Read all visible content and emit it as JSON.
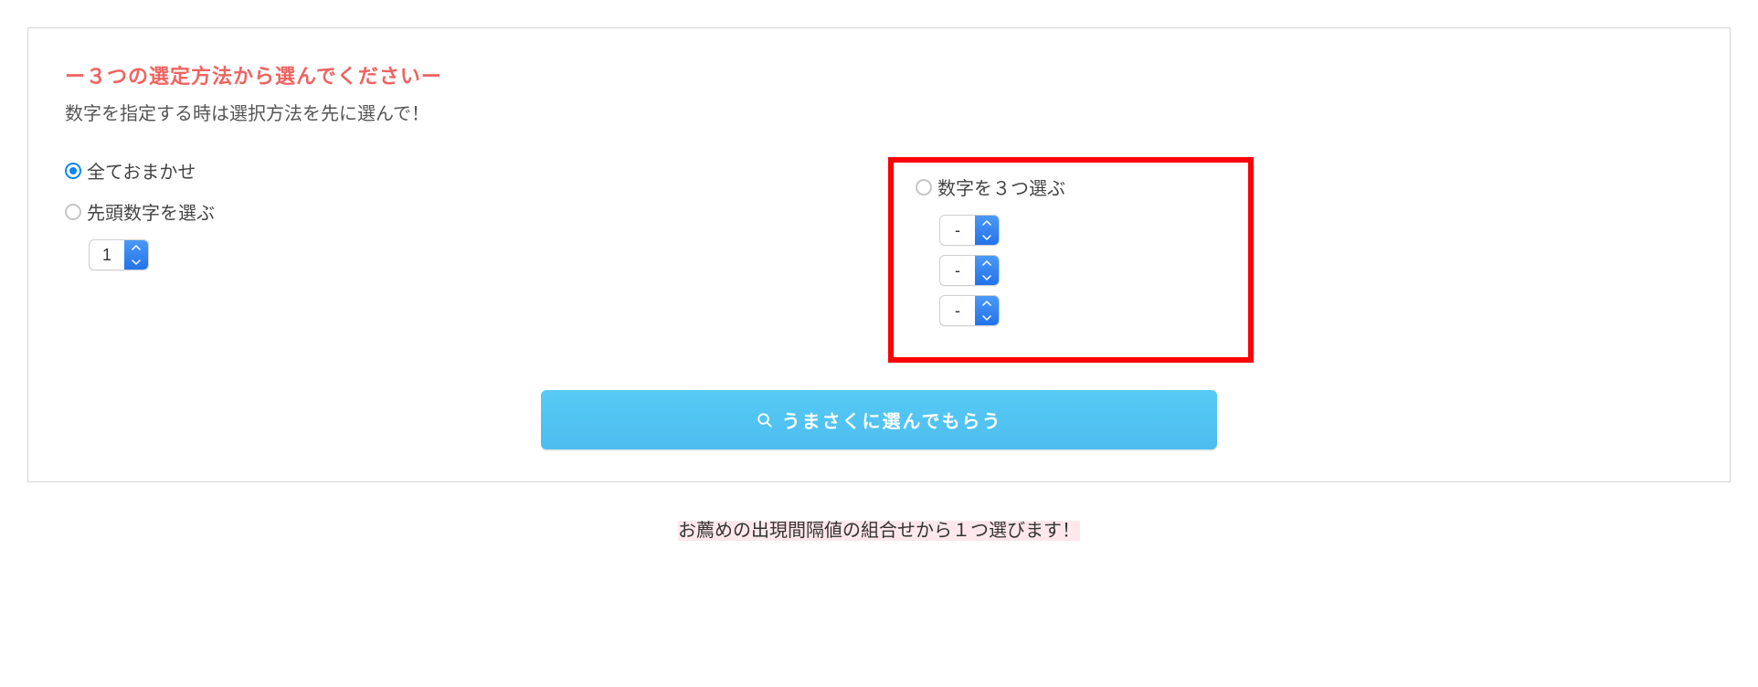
{
  "header": {
    "title": "ー３つの選定方法から選んでくださいー",
    "subtitle": "数字を指定する時は選択方法を先に選んで！"
  },
  "options": {
    "auto": {
      "label": "全ておまかせ",
      "checked": true
    },
    "firstDigit": {
      "label": "先頭数字を選ぶ",
      "checked": false,
      "value": "1"
    },
    "threeDigits": {
      "label": "数字を３つ選ぶ",
      "checked": false,
      "values": [
        "-",
        "-",
        "-"
      ]
    }
  },
  "submit": {
    "label": "うまさくに選んでもらう"
  },
  "footer": {
    "text": "お薦めの出現間隔値の組合せから１つ選びます！"
  }
}
